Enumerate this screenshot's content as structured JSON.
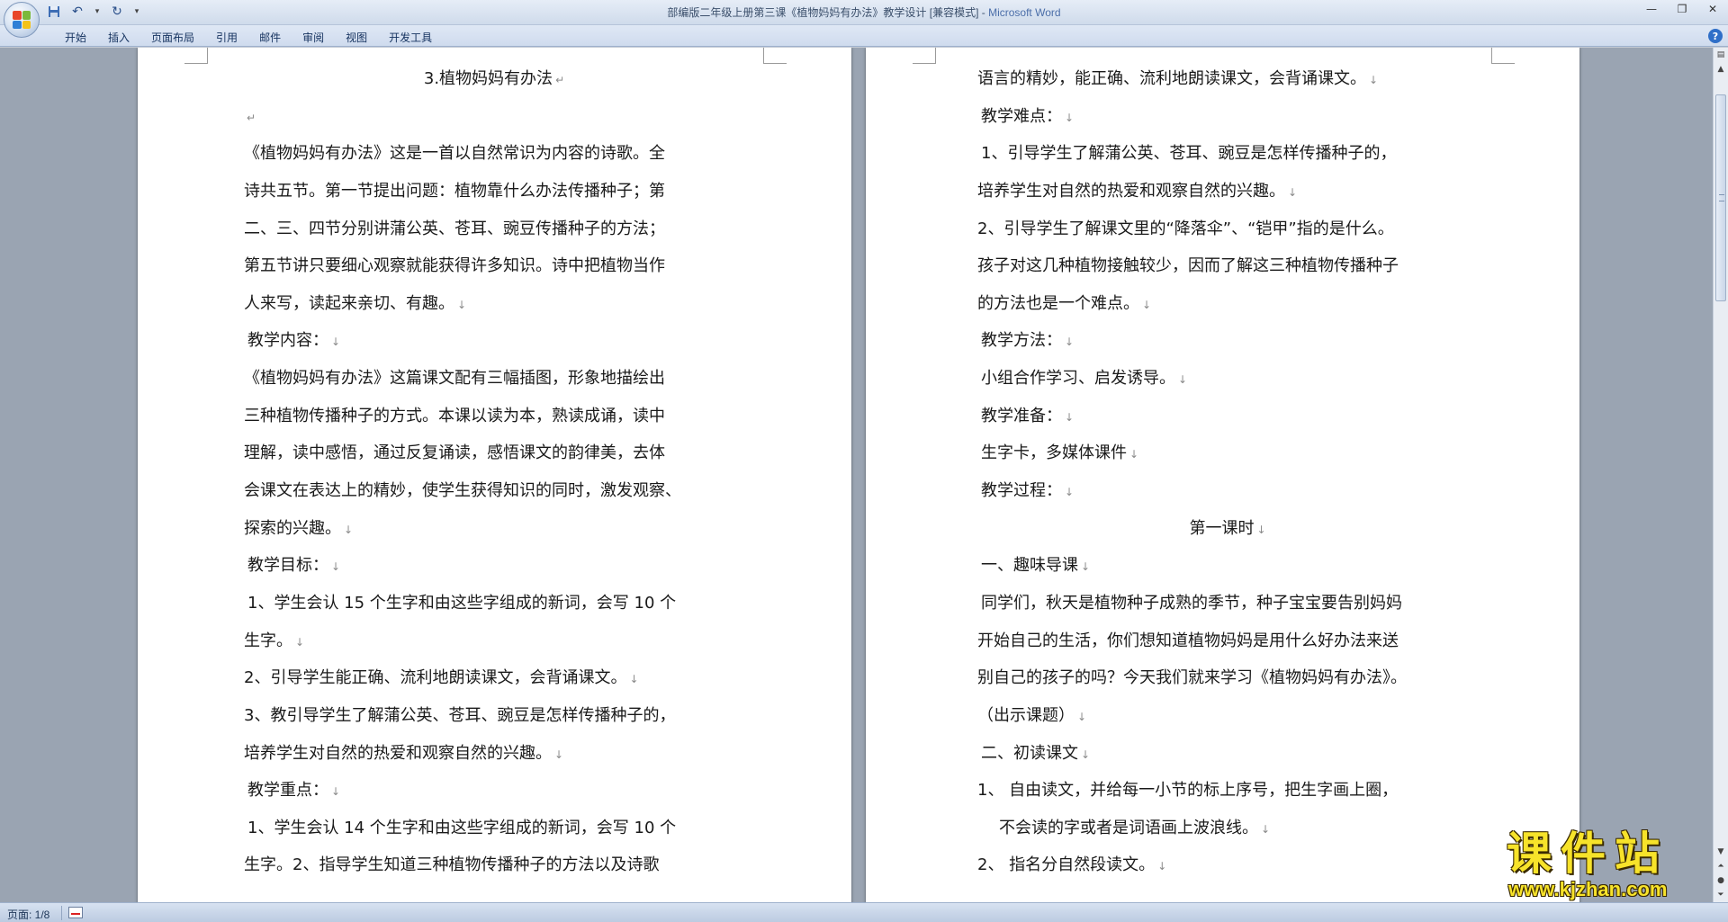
{
  "window": {
    "title": "部编版二年级上册第三课《植物妈妈有办法》教学设计 [兼容模式] - ",
    "app_name": "Microsoft Word"
  },
  "quick_access": [
    "save-icon",
    "undo-icon",
    "redo-icon",
    "customize-icon"
  ],
  "ribbon_tabs": [
    "开始",
    "插入",
    "页面布局",
    "引用",
    "邮件",
    "审阅",
    "视图",
    "开发工具"
  ],
  "help_label": "?",
  "pages": [
    {
      "lines": [
        {
          "text": "3.植物妈妈有办法",
          "mark": "↵",
          "align": "center"
        },
        {
          "text": "",
          "mark": "↵"
        },
        {
          "text": "《植物妈妈有办法》这是一首以自然常识为内容的诗歌。全",
          "mark": ""
        },
        {
          "text": "诗共五节。第一节提出问题：植物靠什么办法传播种子；第",
          "mark": ""
        },
        {
          "text": "二、三、四节分别讲蒲公英、苍耳、豌豆传播种子的方法；",
          "mark": ""
        },
        {
          "text": "第五节讲只要细心观察就能获得许多知识。诗中把植物当作",
          "mark": ""
        },
        {
          "text": "人来写，读起来亲切、有趣。",
          "mark": "↓"
        },
        {
          "text": "教学内容：",
          "mark": "↓",
          "indent": true
        },
        {
          "text": "《植物妈妈有办法》这篇课文配有三幅插图，形象地描绘出",
          "mark": ""
        },
        {
          "text": "三种植物传播种子的方式。本课以读为本，熟读成诵，读中",
          "mark": ""
        },
        {
          "text": "理解，读中感悟，通过反复诵读，感悟课文的韵律美，去体",
          "mark": ""
        },
        {
          "text": "会课文在表达上的精妙，使学生获得知识的同时，激发观察、",
          "mark": ""
        },
        {
          "text": "探索的兴趣。",
          "mark": "↓"
        },
        {
          "text": "教学目标：",
          "mark": "↓",
          "indent": true
        },
        {
          "text": "1、学生会认 15 个生字和由这些字组成的新词，会写 10 个",
          "mark": "",
          "indent": true
        },
        {
          "text": "生字。",
          "mark": "↓"
        },
        {
          "text": "2、引导学生能正确、流利地朗读课文，会背诵课文。",
          "mark": "↓"
        },
        {
          "text": "3、教引导学生了解蒲公英、苍耳、豌豆是怎样传播种子的，",
          "mark": ""
        },
        {
          "text": "培养学生对自然的热爱和观察自然的兴趣。",
          "mark": "↓"
        },
        {
          "text": "教学重点：",
          "mark": "↓",
          "indent": true
        },
        {
          "text": "1、学生会认 14 个生字和由这些字组成的新词，会写 10 个",
          "mark": "",
          "indent": true
        },
        {
          "text": "生字。2、指导学生知道三种植物传播种子的方法以及诗歌",
          "mark": ""
        }
      ]
    },
    {
      "lines": [
        {
          "text": "语言的精妙，能正确、流利地朗读课文，会背诵课文。",
          "mark": "↓"
        },
        {
          "text": "教学难点：",
          "mark": "↓",
          "indent": true
        },
        {
          "text": "1、引导学生了解蒲公英、苍耳、豌豆是怎样传播种子的，",
          "mark": "",
          "indent": true
        },
        {
          "text": "培养学生对自然的热爱和观察自然的兴趣。",
          "mark": "↓"
        },
        {
          "text": "2、引导学生了解课文里的“降落伞”、“铠甲”指的是什么。",
          "mark": ""
        },
        {
          "text": "孩子对这几种植物接触较少，因而了解这三种植物传播种子",
          "mark": ""
        },
        {
          "text": "的方法也是一个难点。",
          "mark": "↓"
        },
        {
          "text": "教学方法：",
          "mark": "↓",
          "indent": true
        },
        {
          "text": "小组合作学习、启发诱导。",
          "mark": "↓",
          "indent": true
        },
        {
          "text": "教学准备：",
          "mark": "↓",
          "indent": true
        },
        {
          "text": "生字卡，多媒体课件",
          "mark": "↓",
          "indent": true
        },
        {
          "text": "教学过程：",
          "mark": "↓",
          "indent": true
        },
        {
          "text": "第一课时",
          "mark": "↓",
          "align": "center"
        },
        {
          "text": "一、趣味导课",
          "mark": "↓",
          "indent": true
        },
        {
          "text": "同学们，秋天是植物种子成熟的季节，种子宝宝要告别妈妈",
          "mark": "",
          "indent": true
        },
        {
          "text": "开始自己的生活，你们想知道植物妈妈是用什么好办法来送",
          "mark": ""
        },
        {
          "text": "别自己的孩子的吗？今天我们就来学习《植物妈妈有办法》。",
          "mark": ""
        },
        {
          "text": "（出示课题）",
          "mark": "↓"
        },
        {
          "text": "二、初读课文",
          "mark": "↓",
          "indent": true
        },
        {
          "text": "1、    自由读文，并给每一小节的标上序号，把生字画上圈，",
          "mark": ""
        },
        {
          "text": "不会读的字或者是词语画上波浪线。",
          "mark": "↓",
          "list_indent": true
        },
        {
          "text": "2、    指名分自然段读文。",
          "mark": "↓"
        }
      ]
    }
  ],
  "status": {
    "page_indicator": "页面: 1/8"
  },
  "watermark": {
    "title": "课件站",
    "url": "www.kjzhan.com"
  },
  "colors": {
    "title_app": "#4b6ea9",
    "watermark": "#f7e32a",
    "workspace": "#9aa4b2"
  }
}
